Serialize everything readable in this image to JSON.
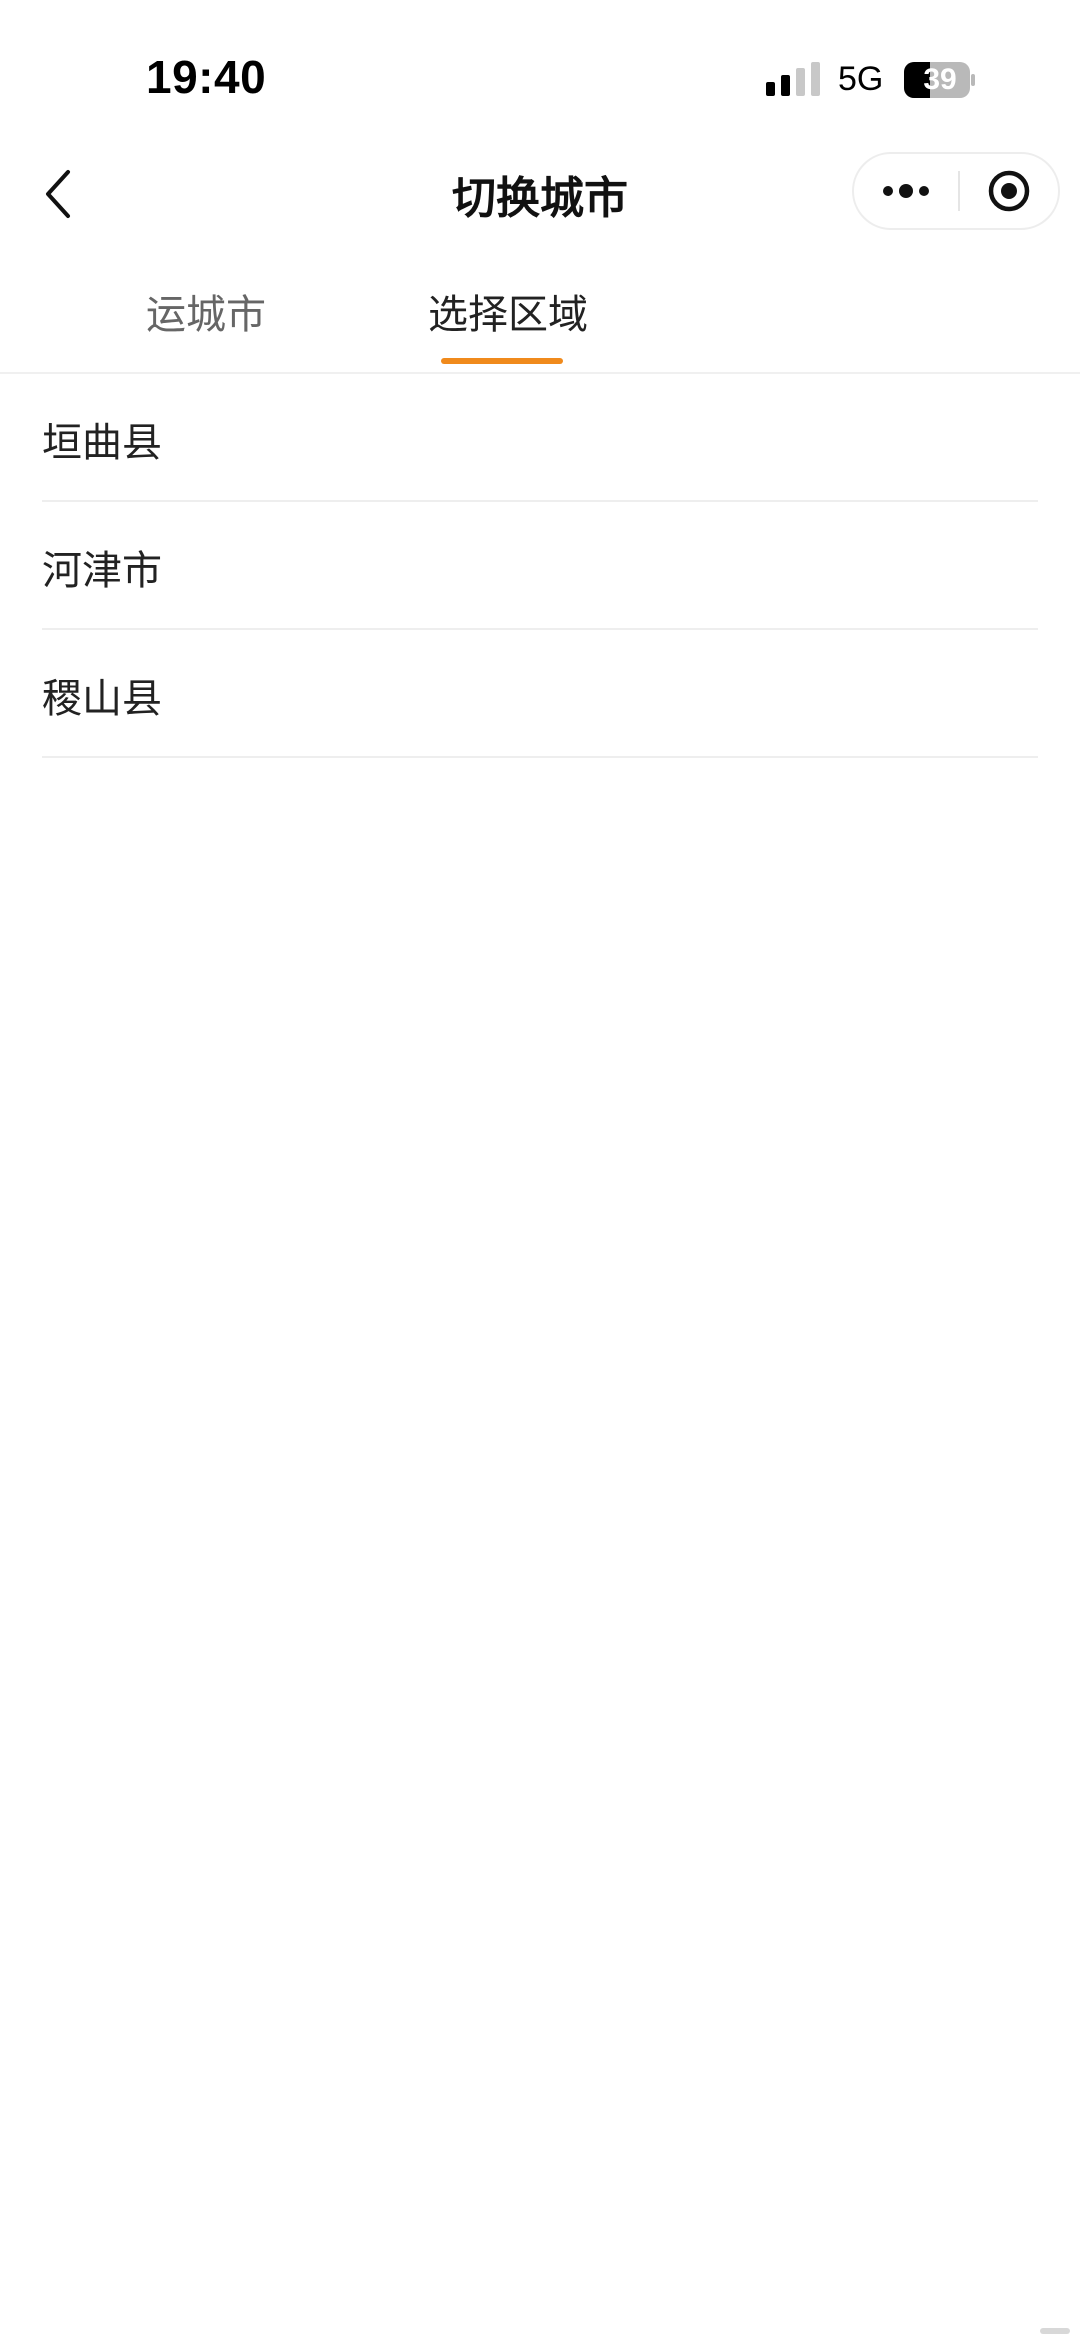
{
  "status_bar": {
    "time": "19:40",
    "network": "5G",
    "battery": "39",
    "signal_icon": "signal-bars-icon",
    "battery_icon": "battery-icon"
  },
  "nav": {
    "title": "切换城市",
    "back_icon": "chevron-left-icon",
    "more_icon": "more-dots-icon",
    "close_icon": "target-circle-icon"
  },
  "tabs": [
    {
      "label": "运城市",
      "active": false
    },
    {
      "label": "选择区域",
      "active": true
    }
  ],
  "areas": [
    {
      "label": "垣曲县"
    },
    {
      "label": "河津市"
    },
    {
      "label": "稷山县"
    }
  ],
  "colors": {
    "accent": "#F08A1C",
    "text_primary": "#222222",
    "text_secondary": "#666666",
    "divider": "#EEEEEE"
  }
}
